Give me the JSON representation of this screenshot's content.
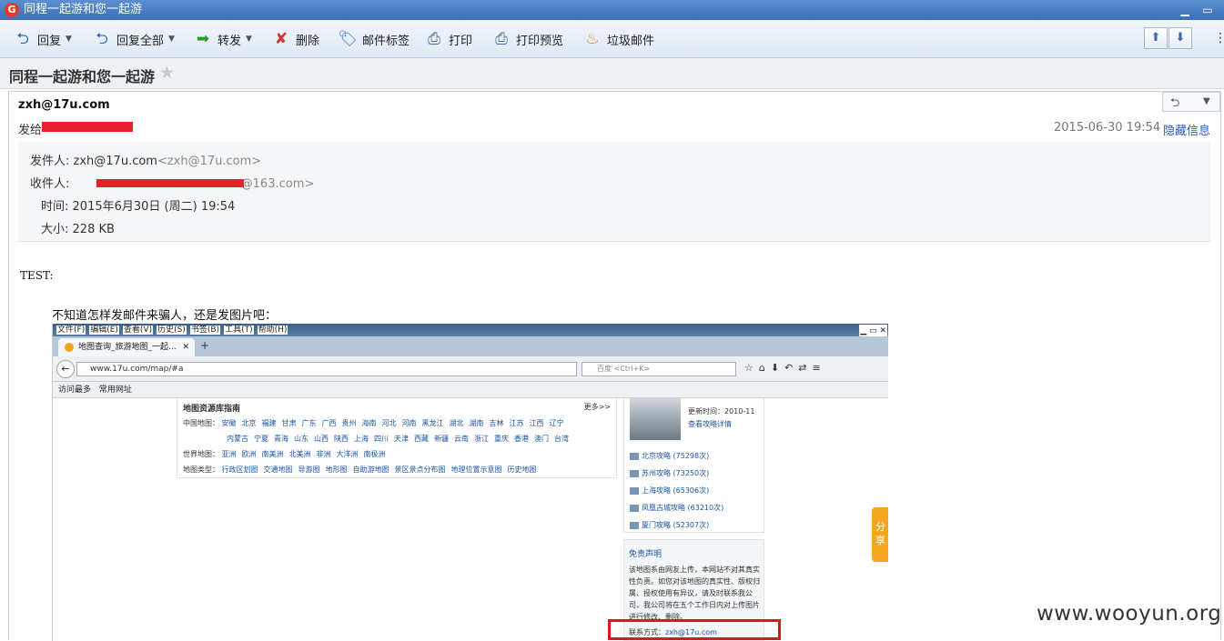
{
  "window": {
    "title": "同程一起游和您一起游",
    "logo": "G"
  },
  "toolbar": {
    "reply": "回复",
    "reply_all": "回复全部",
    "forward": "转发",
    "delete": "删除",
    "tag": "邮件标签",
    "print": "打印",
    "print_preview": "打印预览",
    "spam": "垃圾邮件"
  },
  "subject": "同程一起游和您一起游",
  "mail": {
    "from_display": "zxh@17u.com",
    "send_to_label": "发给",
    "datetime": "2015-06-30 19:54",
    "hide_info": "隐藏信息",
    "sender_label": "发件人:",
    "sender_name": "zxh@17u.com",
    "sender_addr": "<zxh@17u.com>",
    "recipient_label": "收件人:",
    "recipient_tail": ".@163.com>",
    "time_label": "时间:",
    "time_value": "2015年6月30日 (周二) 19:54",
    "size_label": "大小:",
    "size_value": "228 KB",
    "body_test": "TEST:",
    "body_text": "不知道怎样发邮件来骗人，还是发图片吧："
  },
  "screenshot": {
    "menu": [
      "文件(F)",
      "编辑(E)",
      "查看(V)",
      "历史(S)",
      "书签(B)",
      "工具(T)",
      "帮助(H)"
    ],
    "tab_title": "地图查询_旅游地图_一起...",
    "url": "www.17u.com/map/#a",
    "search_placeholder": "百度 <Ctrl+K>",
    "bookmarks": [
      "访问最多",
      "常用网址"
    ],
    "map_header": "地图资源库指南",
    "map_more": "更多>>",
    "china_label": "中国地图：",
    "china_row1": [
      "安徽",
      "北京",
      "福建",
      "甘肃",
      "广东",
      "广西",
      "贵州",
      "海南",
      "河北",
      "河南",
      "黑龙江",
      "湖北",
      "湖南",
      "吉林",
      "江苏",
      "江西",
      "辽宁"
    ],
    "china_row2": [
      "内蒙古",
      "宁夏",
      "青海",
      "山东",
      "山西",
      "陕西",
      "上海",
      "四川",
      "天津",
      "西藏",
      "新疆",
      "云南",
      "浙江",
      "重庆",
      "香港",
      "澳门",
      "台湾"
    ],
    "world_label": "世界地图：",
    "world_row": [
      "亚洲",
      "欧洲",
      "南美洲",
      "北美洲",
      "非洲",
      "大洋洲",
      "南极洲"
    ],
    "type_label": "地图类型：",
    "type_row": [
      "行政区划图",
      "交通地图",
      "导游图",
      "地形图",
      "自助游地图",
      "景区景点分布图",
      "地理位置示意图",
      "历史地图"
    ],
    "update_time": "更新时间：2010-11",
    "view_guide": "查看攻略详情",
    "guides": [
      "北京攻略 (75298次)",
      "苏州攻略 (73250次)",
      "上海攻略 (65306次)",
      "凤凰古城攻略 (63210次)",
      "厦门攻略 (52307次)"
    ],
    "disclaimer_title": "免责声明",
    "disclaimer_text": "该地图系由网友上传，本网站不对其真实性负责。如您对该地图的真实性、版权归属、授权使用有异议，请及时联系我公司，我公司将在五个工作日内对上传图片进行修改、删除。",
    "contact_label": "联系方式：",
    "contact_email": "zxh@17u.com",
    "share": "分享"
  },
  "watermark": "www.wooyun.org",
  "colors": {
    "redaction": "#e8202a",
    "link": "#2a5db0",
    "highlight_box": "#e0141d"
  }
}
